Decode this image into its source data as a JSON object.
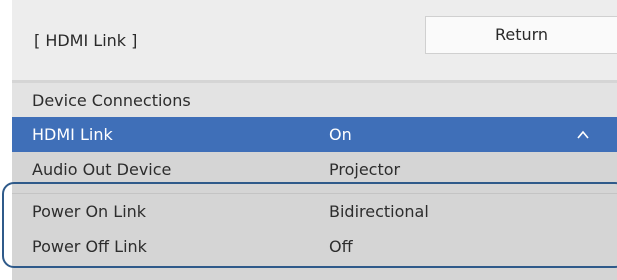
{
  "header": {
    "title": "[ HDMI Link ]",
    "return_label": "Return"
  },
  "section": {
    "label": "Device Connections"
  },
  "rows": [
    {
      "label": "HDMI Link",
      "value": "On",
      "icon": "chevron-up-icon",
      "selected": true
    },
    {
      "label": "Audio Out Device",
      "value": "Projector"
    },
    {
      "label": "Power On Link",
      "value": "Bidirectional"
    },
    {
      "label": "Power Off Link",
      "value": "Off"
    }
  ],
  "colors": {
    "selected_bg": "#3f6fb8",
    "outline": "#2f5a8a",
    "panel_bg": "#d5d5d5"
  }
}
